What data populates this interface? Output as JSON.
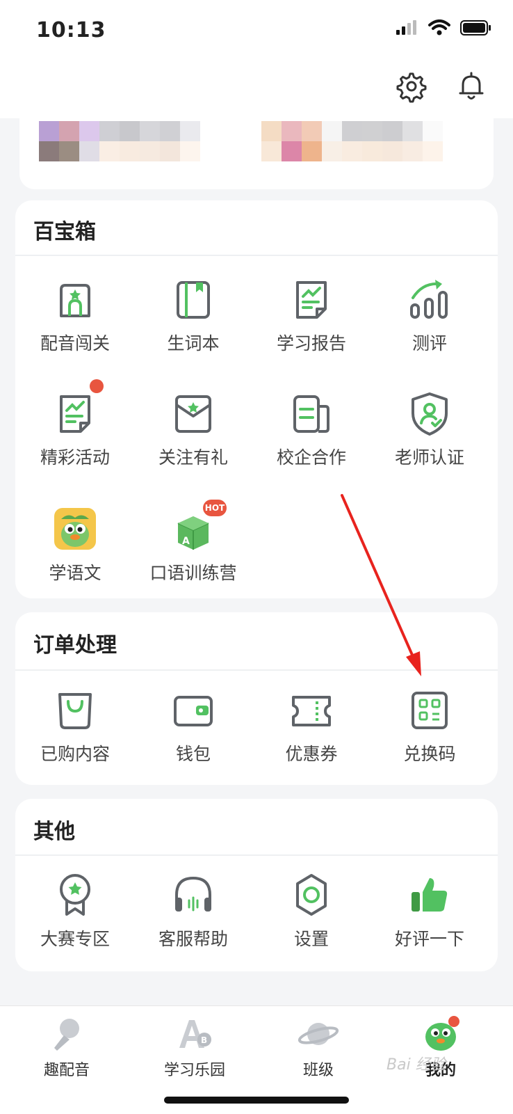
{
  "status_bar": {
    "time": "10:13"
  },
  "sections": [
    {
      "title": "百宝箱",
      "items": [
        {
          "label": "配音闯关",
          "icon": "dubbing-level-icon"
        },
        {
          "label": "生词本",
          "icon": "vocabulary-book-icon"
        },
        {
          "label": "学习报告",
          "icon": "study-report-icon"
        },
        {
          "label": "测评",
          "icon": "assessment-icon"
        },
        {
          "label": "精彩活动",
          "icon": "activities-icon"
        },
        {
          "label": "关注有礼",
          "icon": "follow-gift-icon"
        },
        {
          "label": "校企合作",
          "icon": "school-cooperation-icon"
        },
        {
          "label": "老师认证",
          "icon": "teacher-certification-icon"
        },
        {
          "label": "学语文",
          "icon": "learn-chinese-app-icon"
        },
        {
          "label": "口语训练营",
          "icon": "speaking-camp-icon",
          "badge": "HOT"
        }
      ]
    },
    {
      "title": "订单处理",
      "items": [
        {
          "label": "已购内容",
          "icon": "purchased-bag-icon"
        },
        {
          "label": "钱包",
          "icon": "wallet-icon"
        },
        {
          "label": "优惠券",
          "icon": "coupon-icon"
        },
        {
          "label": "兑换码",
          "icon": "redeem-code-icon"
        }
      ]
    },
    {
      "title": "其他",
      "items": [
        {
          "label": "大赛专区",
          "icon": "contest-medal-icon"
        },
        {
          "label": "客服帮助",
          "icon": "customer-service-headset-icon"
        },
        {
          "label": "设置",
          "icon": "settings-gear-icon"
        },
        {
          "label": "好评一下",
          "icon": "thumbs-up-icon"
        }
      ]
    }
  ],
  "tab_bar": [
    {
      "label": "趣配音",
      "icon": "microphone-icon"
    },
    {
      "label": "学习乐园",
      "icon": "abc-letters-icon"
    },
    {
      "label": "班级",
      "icon": "planet-icon"
    },
    {
      "label": "我的",
      "icon": "mascot-avatar-icon",
      "active": true
    }
  ],
  "watermark": "Bai 经验",
  "colors": {
    "accent": "#52c161",
    "icon_stroke": "#5f6368",
    "badge_red": "#e8553f",
    "arrow_red": "#e8231e"
  }
}
